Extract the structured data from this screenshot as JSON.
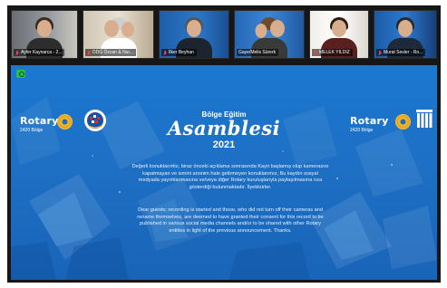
{
  "participants": [
    {
      "name": "Ayfer Kaynarca - 2...",
      "muted": true,
      "scene": "office",
      "hair": "#3a2a20",
      "shirt": "#2d2d2d"
    },
    {
      "name": "DDG Özcan & Nur...",
      "muted": true,
      "scene": "home",
      "hair": "#cfcfcf",
      "shirt": "#ffffff"
    },
    {
      "name": "İlker Beyhan",
      "muted": true,
      "scene": "blue",
      "hair": "#555555",
      "shirt": "#1c2430"
    },
    {
      "name": "Gaye/Melis Sürerk",
      "muted": false,
      "scene": "blue",
      "hair": "#6b4a2e",
      "shirt": "#3a3a3a"
    },
    {
      "name": "MELEK YILDIZ",
      "muted": true,
      "scene": "bright",
      "hair": "#2a1d14",
      "shirt": "#5a2020"
    },
    {
      "name": "Murat Sesler - Ro...",
      "muted": true,
      "scene": "blue",
      "hair": "#2a2a2a",
      "shirt": "#1e2a3a"
    }
  ],
  "slide": {
    "left_logo": {
      "word": "Rotary",
      "district": "2420 Bölge"
    },
    "right_logo": {
      "word": "Rotary",
      "district": "2420 Bölge"
    },
    "title_small": "Bölge Eğitim",
    "title_big": "Asamblesi",
    "year": "2021",
    "paragraph_tr": "Değerli konuklarımız, biraz önceki açıklama sonrasında Kayıt başlamış olup kamerasını kapatmayan ve ismini anonim hale getirmeyen konuklarımız, Bu kaydın sosyal medyada yayımlanmasına ve/veya diğer Rotary kuruluşlarıyla paylaşılmasına rıza gösterdiği bulunmaktadır. İlyekkürler.",
    "paragraph_en": "Dear guests; recording is started and those, who did not turn off their cameras and rename themselves, are deemed to have granted their consent for this record to be published in various social media channels and/or to be shared with other Rotary entities in light of the previous announcement.  Thanks."
  },
  "colors": {
    "slide_blue": "#1c78cf",
    "rotary_gold": "#f3b62b",
    "share_green": "#28c04a",
    "muted_red": "#ff3b3b"
  }
}
